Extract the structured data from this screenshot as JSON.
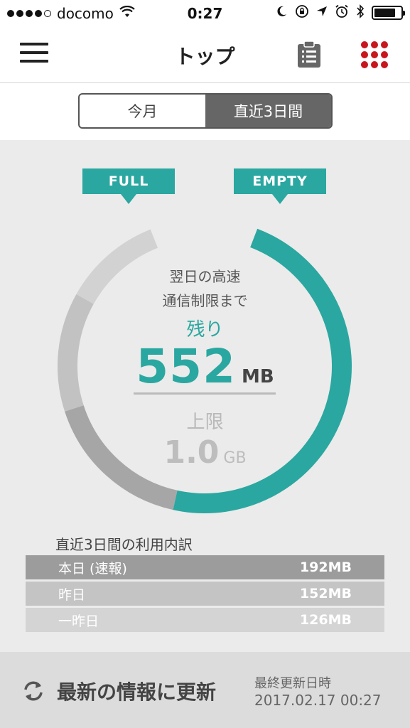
{
  "status_bar": {
    "carrier": "docomo",
    "time": "0:27",
    "signal_dots_filled": 4,
    "signal_dots_total": 5,
    "battery_level": 0.8,
    "icons": [
      "wifi-icon",
      "moon-icon",
      "rotation-lock-icon",
      "location-icon",
      "alarm-icon",
      "bluetooth-icon",
      "battery-icon"
    ]
  },
  "nav": {
    "title": "トップ",
    "icons": [
      "hamburger-menu-icon",
      "clipboard-icon",
      "grid-dots-icon"
    ]
  },
  "segment": {
    "options": [
      "今月",
      "直近3日間"
    ],
    "selected": 1
  },
  "gauge": {
    "full_label": "FULL",
    "empty_label": "EMPTY",
    "caption_line1": "翌日の高速",
    "caption_line2": "通信制限まで",
    "remaining_label": "残り",
    "remaining_value": "552",
    "remaining_unit": "MB",
    "limit_label": "上限",
    "limit_value": "1.0",
    "limit_unit": "GB",
    "remaining_mb": 552,
    "used_segments_mb": [
      192,
      152,
      126
    ],
    "limit_mb": 1024,
    "colors": {
      "remaining": "#2aa7a0",
      "segment_today": "#a6a6a6",
      "segment_yesterday": "#c2c2c2",
      "segment_day_before": "#d2d2d2"
    }
  },
  "breakdown": {
    "title": "直近3日間の利用内訳",
    "rows": [
      {
        "label": "本日 (速報)",
        "value": "192MB"
      },
      {
        "label": "昨日",
        "value": "152MB"
      },
      {
        "label": "一昨日",
        "value": "126MB"
      }
    ]
  },
  "footer": {
    "refresh_label": "最新の情報に更新",
    "last_updated_label": "最終更新日時",
    "last_updated_value": "2017.02.17 00:27"
  },
  "accent_color": "#2aa7a0",
  "brand_red": "#c8161d"
}
